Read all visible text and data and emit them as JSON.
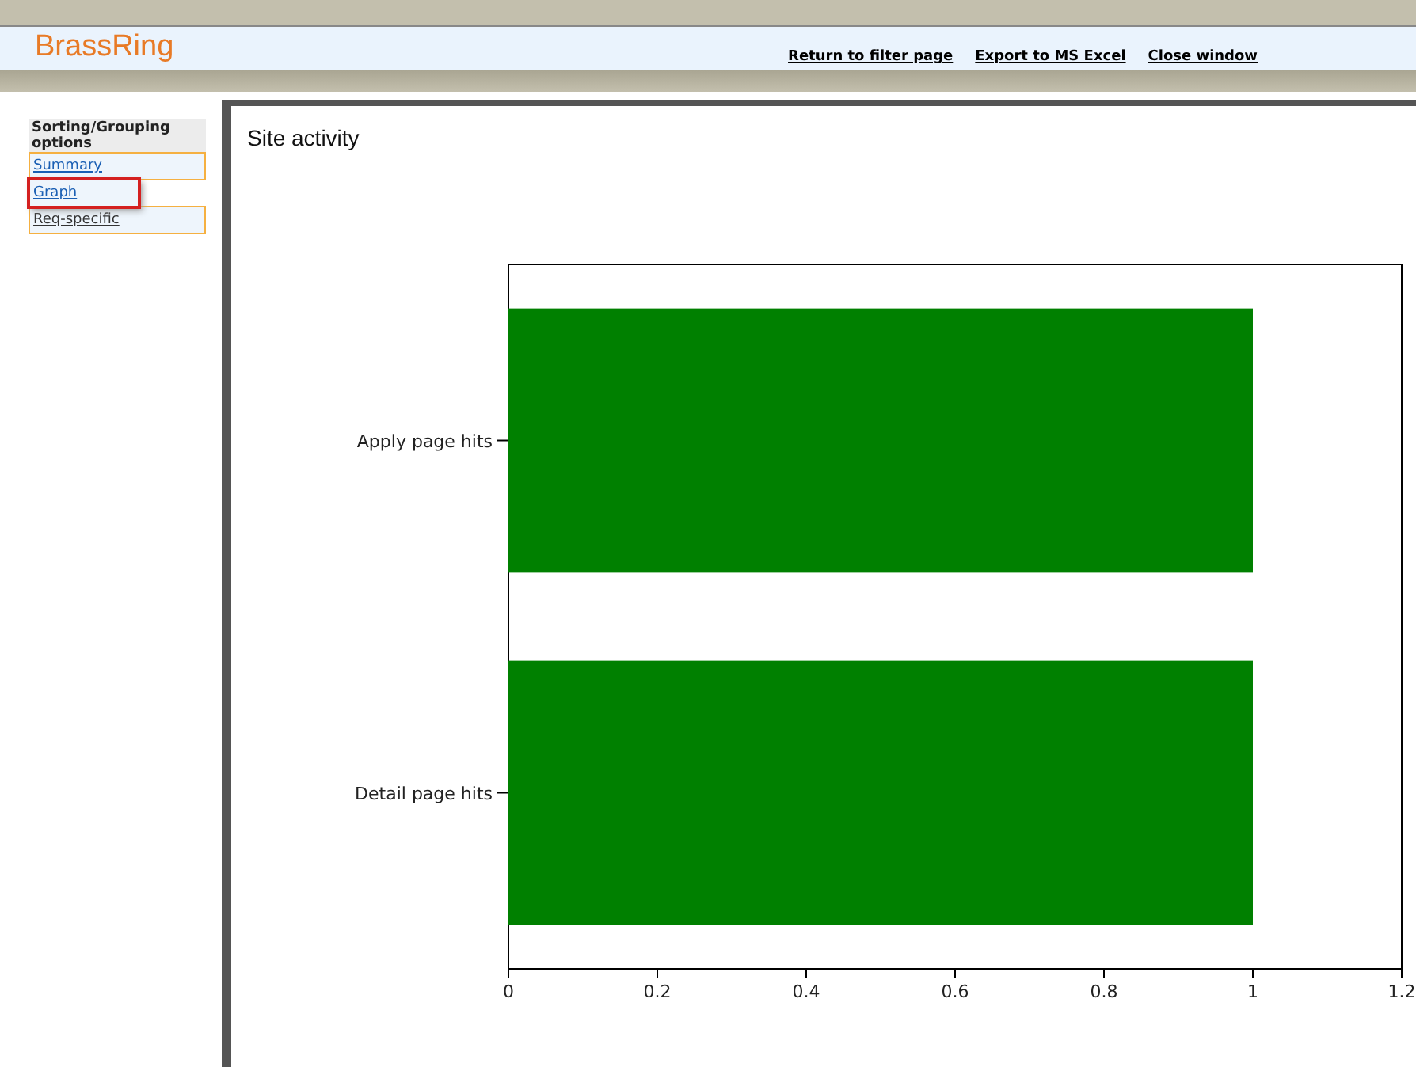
{
  "header": {
    "logo": "BrassRing",
    "links": [
      "Return to filter page",
      "Export to MS Excel",
      "Close window"
    ]
  },
  "sidebar": {
    "heading": "Sorting/Grouping options",
    "items": [
      {
        "label": "Summary",
        "kind": "link",
        "selected": false
      },
      {
        "label": "Graph",
        "kind": "link",
        "selected": true
      },
      {
        "label": "Req-specific",
        "kind": "plain",
        "selected": false
      }
    ]
  },
  "main": {
    "title": "Site activity",
    "chart_data": {
      "type": "bar",
      "orientation": "horizontal",
      "categories": [
        "Apply page hits",
        "Detail page hits"
      ],
      "series": [
        {
          "color": "#008000",
          "values": [
            1,
            1
          ]
        }
      ],
      "xlim": [
        0,
        1.2
      ],
      "xticks": [
        0,
        0.2,
        0.4,
        0.6,
        0.8,
        1,
        {
          "value": 1.2,
          "label": "1.2"
        }
      ]
    }
  }
}
